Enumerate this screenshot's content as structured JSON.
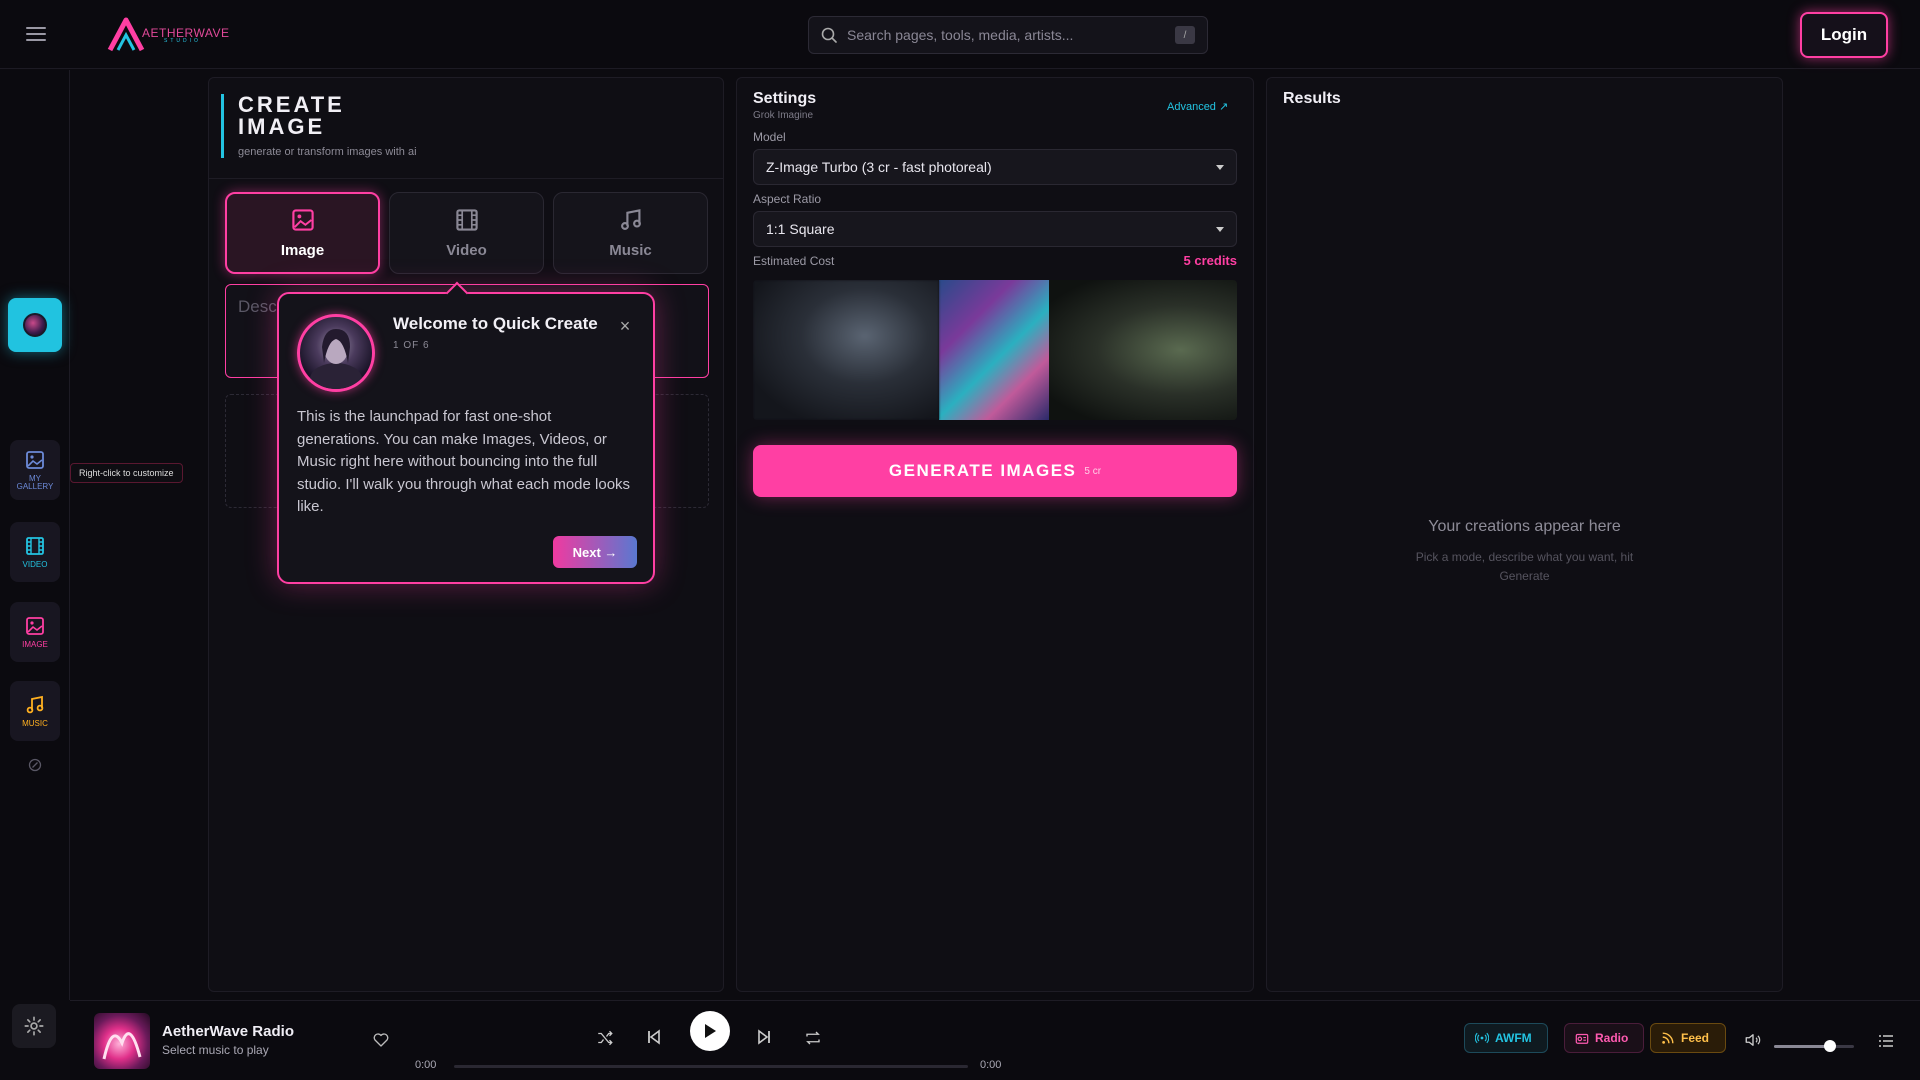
{
  "brand": {
    "name": "AETHERWAVE",
    "sub": "STUDIO"
  },
  "search": {
    "placeholder": "Search pages, tools, media, artists...",
    "shortcut": "/"
  },
  "header": {
    "login_label": "Login"
  },
  "rail": {
    "items": [
      {
        "label": "MY GALLERY",
        "icon": "gallery-icon",
        "color": "#6c8ad8"
      },
      {
        "label": "VIDEO",
        "icon": "film-icon",
        "color": "#23c4e2"
      },
      {
        "label": "IMAGE",
        "icon": "image-icon",
        "color": "#ff3fa3"
      },
      {
        "label": "MUSIC",
        "icon": "music-icon",
        "color": "#ffb020"
      }
    ],
    "tooltip": "Right-click to customize"
  },
  "create": {
    "title": "CREATE IMAGE",
    "subtitle": "generate or transform images with ai",
    "modes": [
      {
        "label": "Image",
        "icon": "image-icon",
        "active": true
      },
      {
        "label": "Video",
        "icon": "film-icon",
        "active": false
      },
      {
        "label": "Music",
        "icon": "music-icon",
        "active": false
      }
    ],
    "prompt_placeholder": "Describe"
  },
  "tour": {
    "title": "Welcome to Quick Create",
    "step": "1 OF 6",
    "body": "This is the launchpad for fast one-shot generations. You can make Images, Videos, or Music right here without bouncing into the full studio. I'll walk you through what each mode looks like.",
    "next_label": "Next →"
  },
  "settings": {
    "title": "Settings",
    "subtitle": "Grok Imagine",
    "advanced_label": "Advanced ↗",
    "model_label": "Model",
    "model_value": "Z-Image Turbo (3 cr - fast photoreal)",
    "aspect_label": "Aspect Ratio",
    "aspect_value": "1:1 Square",
    "cost_label": "Estimated Cost",
    "cost_value": "5 credits",
    "generate_label": "GENERATE IMAGES",
    "generate_cost": "5 cr"
  },
  "results": {
    "title": "Results",
    "empty_title": "Your creations appear here",
    "empty_sub": "Pick a mode, describe what you want, hit Generate"
  },
  "player": {
    "title": "AetherWave Radio",
    "subtitle": "Select music to play",
    "time_current": "0:00",
    "time_total": "0:00",
    "progress": 0,
    "chips": {
      "awfm": "AWFM",
      "radio": "Radio",
      "feed": "Feed"
    },
    "volume": 0.7
  },
  "colors": {
    "accent": "#ff3fa3",
    "cyan": "#23c4e2",
    "amber": "#ffc04a",
    "bg": "#0c0b10"
  }
}
